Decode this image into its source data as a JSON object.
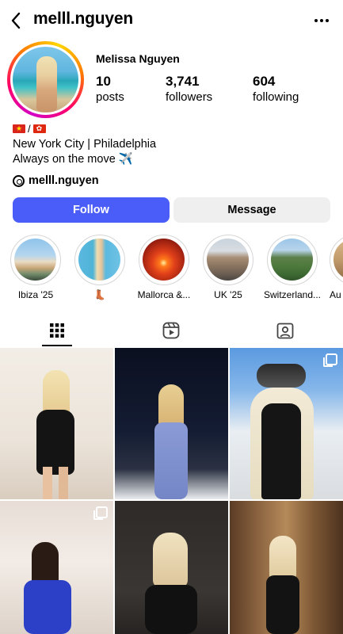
{
  "header": {
    "username": "melll.nguyen",
    "back_icon": "chevron-left-icon",
    "more_icon": "more-horizontal-icon"
  },
  "profile": {
    "full_name": "Melissa Nguyen",
    "stats": [
      {
        "num": "10",
        "label": "posts"
      },
      {
        "num": "3,741",
        "label": "followers"
      },
      {
        "num": "604",
        "label": "following"
      }
    ],
    "flags_separator": "/",
    "bio_lines": [
      "New York City | Philadelphia",
      "Always on the move ✈️"
    ],
    "threads_handle": "melll.nguyen"
  },
  "actions": {
    "follow_label": "Follow",
    "message_label": "Message"
  },
  "highlights": [
    {
      "label": "Ibiza '25"
    },
    {
      "label": "👢"
    },
    {
      "label": "Mallorca &..."
    },
    {
      "label": "UK '25"
    },
    {
      "label": "Switzerland..."
    },
    {
      "label": "Au"
    }
  ],
  "tabs": [
    {
      "icon": "grid-icon",
      "active": true
    },
    {
      "icon": "reels-icon",
      "active": false
    },
    {
      "icon": "tagged-icon",
      "active": false
    }
  ],
  "colors": {
    "follow_button": "#4a5df9",
    "message_button": "#efefef"
  }
}
